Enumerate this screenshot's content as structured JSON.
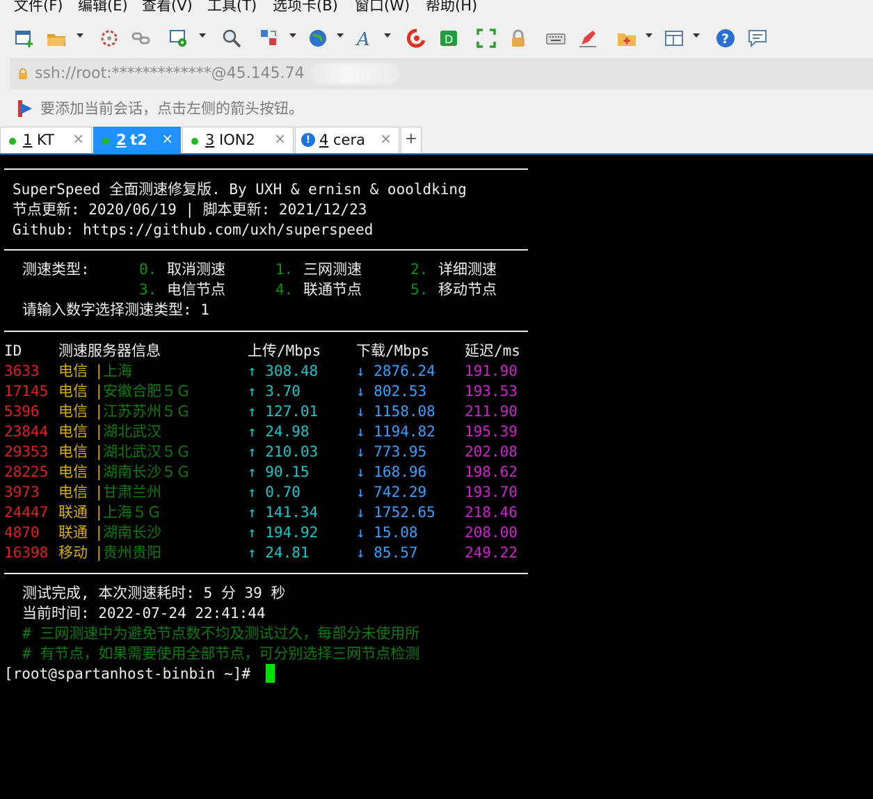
{
  "menu": [
    "文件(F)",
    "编辑(E)",
    "查看(V)",
    "工具(T)",
    "选项卡(B)",
    "窗口(W)",
    "帮助(H)"
  ],
  "address": {
    "url": "ssh://root:*************@45.145.74"
  },
  "hint": {
    "text": "要添加当前会话，点击左侧的箭头按钮。"
  },
  "tabs": [
    {
      "num": "1",
      "label": "KT",
      "status": "connected"
    },
    {
      "num": "2",
      "label": "t2",
      "status": "connected",
      "active": true
    },
    {
      "num": "3",
      "label": "ION2",
      "status": "connected"
    },
    {
      "num": "4",
      "label": "cera",
      "status": "warning"
    }
  ],
  "plus_label": "+",
  "close_label": "×",
  "terminal": {
    "banner": [
      "SuperSpeed 全面测速修复版. By UXH & ernisn & oooldking",
      "节点更新: 2020/06/19 | 脚本更新: 2021/12/23",
      "Github: https://github.com/uxh/superspeed"
    ],
    "menu_label": "测速类型:",
    "options": [
      {
        "key": "0.",
        "label": "取消测速"
      },
      {
        "key": "1.",
        "label": "三网测速"
      },
      {
        "key": "2.",
        "label": "详细测速"
      },
      {
        "key": "3.",
        "label": "电信节点"
      },
      {
        "key": "4.",
        "label": "联通节点"
      },
      {
        "key": "5.",
        "label": "移动节点"
      }
    ],
    "prompt": "请输入数字选择测速类型: 1",
    "headers": [
      "ID",
      "测速服务器信息",
      "上传/Mbps",
      "下载/Mbps",
      "延迟/ms"
    ],
    "rows": [
      {
        "id": "3633",
        "isp": "电信",
        "sep": "|",
        "loc": "上海",
        "up": "↑ 308.48",
        "down": "↓ 2876.24",
        "lat": "191.90"
      },
      {
        "id": "17145",
        "isp": "电信",
        "sep": "|",
        "loc": "安徽合肥５Ｇ",
        "up": "↑ 3.70",
        "down": "↓ 802.53",
        "lat": "193.53"
      },
      {
        "id": "5396",
        "isp": "电信",
        "sep": "|",
        "loc": "江苏苏州５Ｇ",
        "up": "↑ 127.01",
        "down": "↓ 1158.08",
        "lat": "211.90"
      },
      {
        "id": "23844",
        "isp": "电信",
        "sep": "|",
        "loc": "湖北武汉",
        "up": "↑ 24.98",
        "down": "↓ 1194.82",
        "lat": "195.39"
      },
      {
        "id": "29353",
        "isp": "电信",
        "sep": "|",
        "loc": "湖北武汉５Ｇ",
        "up": "↑ 210.03",
        "down": "↓ 773.95",
        "lat": "202.08"
      },
      {
        "id": "28225",
        "isp": "电信",
        "sep": "|",
        "loc": "湖南长沙５Ｇ",
        "up": "↑ 90.15",
        "down": "↓ 168.96",
        "lat": "198.62"
      },
      {
        "id": "3973",
        "isp": "电信",
        "sep": "|",
        "loc": "甘肃兰州",
        "up": "↑ 0.70",
        "down": "↓ 742.29",
        "lat": "193.70"
      },
      {
        "id": "24447",
        "isp": "联通",
        "sep": "|",
        "loc": "上海５Ｇ",
        "up": "↑ 141.34",
        "down": "↓ 1752.65",
        "lat": "218.46"
      },
      {
        "id": "4870",
        "isp": "联通",
        "sep": "|",
        "loc": "湖南长沙",
        "up": "↑ 194.92",
        "down": "↓ 15.08",
        "lat": "208.00"
      },
      {
        "id": "16398",
        "isp": "移动",
        "sep": "|",
        "loc": "贵州贵阳",
        "up": "↑ 24.81",
        "down": "↓ 85.57",
        "lat": "249.22"
      }
    ],
    "done": "测试完成, 本次测速耗时: 5 分 39 秒",
    "time": "当前时间: 2022-07-24 22:41:44",
    "notes": [
      "# 三网测速中为避免节点数不均及测试过久，每部分未使用所",
      "# 有节点，如果需要使用全部节点，可分别选择三网节点检测"
    ],
    "shell_prompt": "[root@spartanhost-binbin ~]#"
  }
}
